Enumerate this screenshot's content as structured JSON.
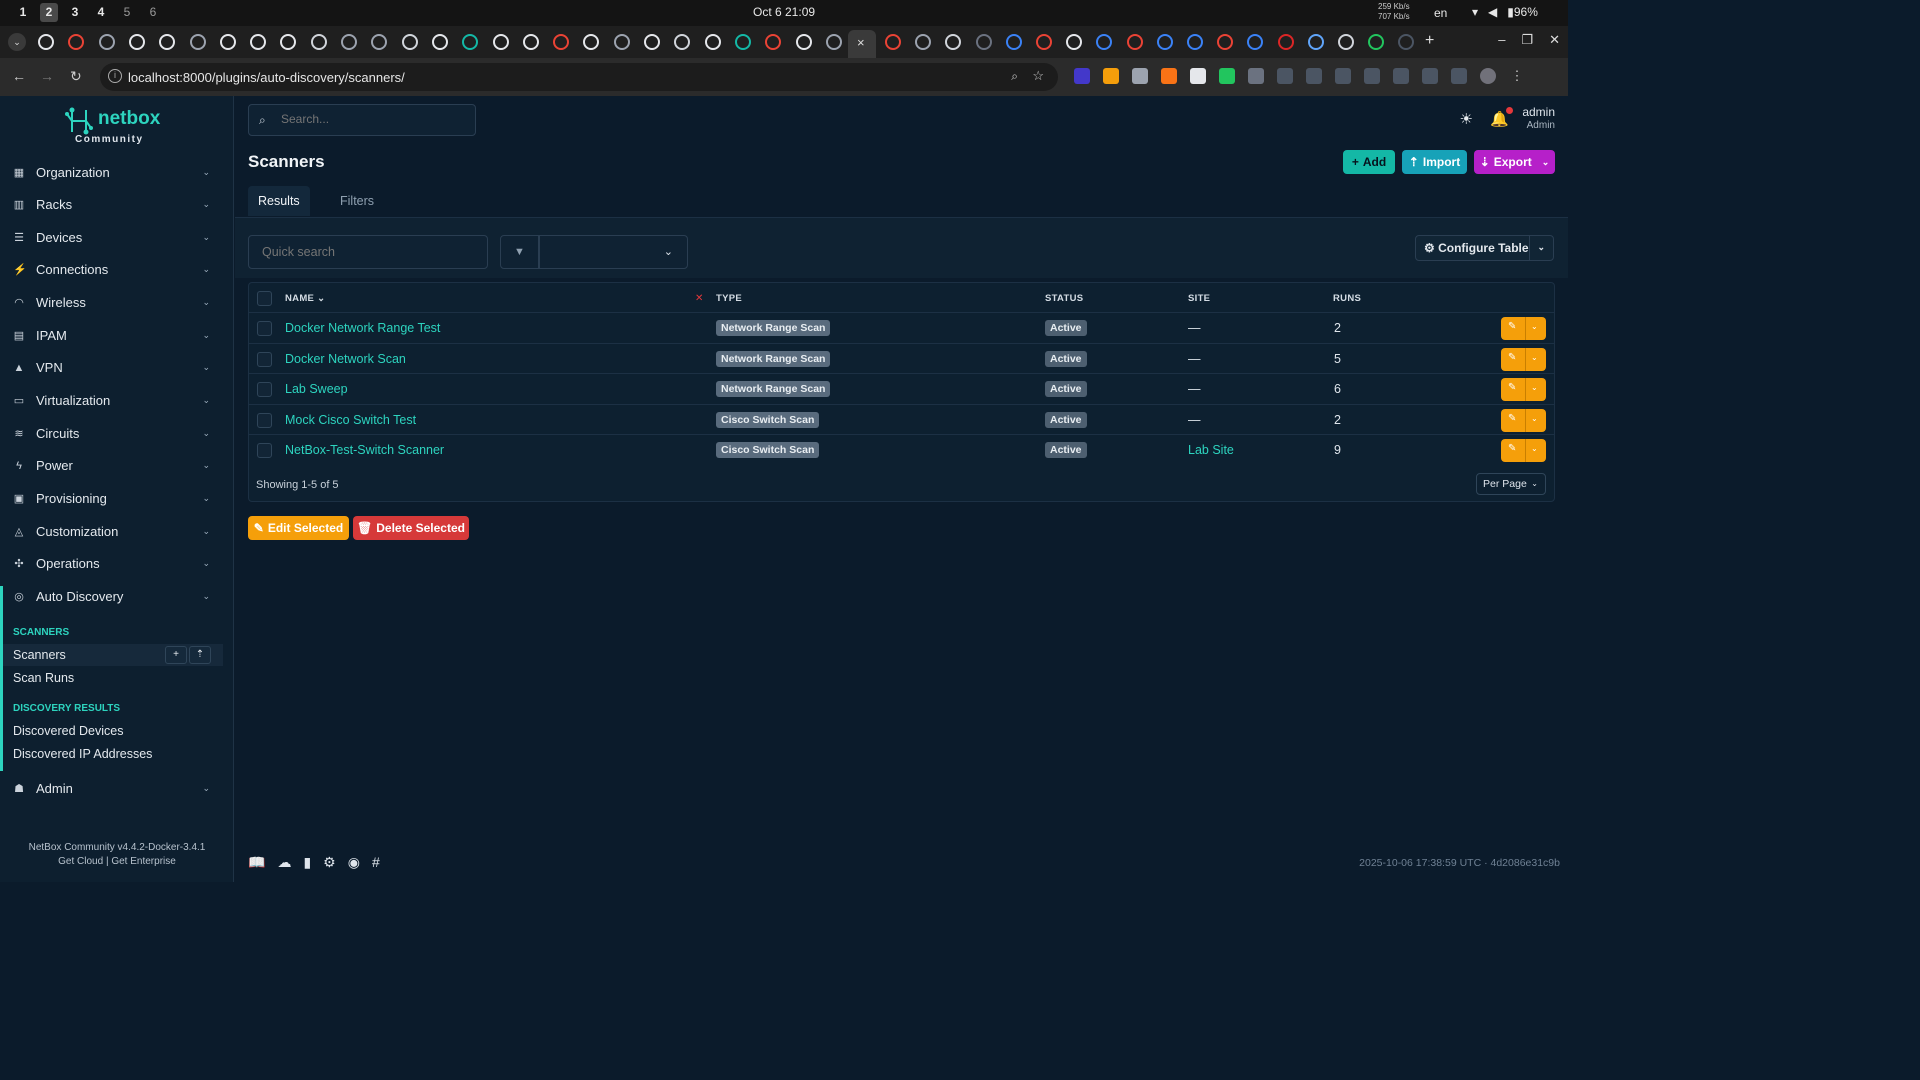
{
  "system": {
    "workspaces": [
      "1",
      "2",
      "3",
      "4",
      "5",
      "6"
    ],
    "active_workspace": "2",
    "clock": "Oct 6  21:09",
    "net_up": "259 Kb/s",
    "net_down": "707 Kb/s",
    "lang": "en",
    "battery": "96%"
  },
  "browser": {
    "url": "localhost:8000/plugins/auto-discovery/scanners/",
    "close_tab": "×",
    "new_tab": "+"
  },
  "sidebar": {
    "brand": "netbox",
    "brand_sub": "Community",
    "items": [
      {
        "label": "Organization",
        "icon": "building-icon"
      },
      {
        "label": "Racks",
        "icon": "grid-icon"
      },
      {
        "label": "Devices",
        "icon": "server-icon"
      },
      {
        "label": "Connections",
        "icon": "plug-icon"
      },
      {
        "label": "Wireless",
        "icon": "wifi-icon"
      },
      {
        "label": "IPAM",
        "icon": "counter-icon"
      },
      {
        "label": "VPN",
        "icon": "tunnel-icon"
      },
      {
        "label": "Virtualization",
        "icon": "monitor-icon"
      },
      {
        "label": "Circuits",
        "icon": "circuit-icon"
      },
      {
        "label": "Power",
        "icon": "bolt-icon"
      },
      {
        "label": "Provisioning",
        "icon": "provision-icon"
      },
      {
        "label": "Customization",
        "icon": "palette-icon"
      },
      {
        "label": "Operations",
        "icon": "cog-icon"
      },
      {
        "label": "Auto Discovery",
        "icon": "radar-icon"
      }
    ],
    "section_scanners": "SCANNERS",
    "scanners_label": "Scanners",
    "scan_runs_label": "Scan Runs",
    "section_results": "DISCOVERY RESULTS",
    "discovered_devices_label": "Discovered Devices",
    "discovered_ips_label": "Discovered IP Addresses",
    "admin_label": "Admin",
    "footer_version": "NetBox Community v4.4.2-Docker-3.4.1",
    "footer_cloud": "Get Cloud",
    "footer_enterprise": "Get Enterprise"
  },
  "header": {
    "search_placeholder": "Search...",
    "username": "admin",
    "user_role": "Admin"
  },
  "page": {
    "title": "Scanners",
    "add_label": "Add",
    "import_label": "Import",
    "export_label": "Export",
    "tab_results": "Results",
    "results_count": "5",
    "tab_filters": "Filters",
    "quick_search_placeholder": "Quick search",
    "configure_table_label": "Configure Table"
  },
  "table": {
    "columns": {
      "name": "NAME",
      "type": "TYPE",
      "status": "STATUS",
      "site": "SITE",
      "runs": "RUNS"
    },
    "rows": [
      {
        "name": "Docker Network Range Test",
        "type": "Network Range Scan",
        "status": "Active",
        "site": "—",
        "runs": "2"
      },
      {
        "name": "Docker Network Scan",
        "type": "Network Range Scan",
        "status": "Active",
        "site": "—",
        "runs": "5"
      },
      {
        "name": "Lab Sweep",
        "type": "Network Range Scan",
        "status": "Active",
        "site": "—",
        "runs": "6"
      },
      {
        "name": "Mock Cisco Switch Test",
        "type": "Cisco Switch Scan",
        "status": "Active",
        "site": "—",
        "runs": "2"
      },
      {
        "name": "NetBox-Test-Switch Scanner",
        "type": "Cisco Switch Scan",
        "status": "Active",
        "site": "Lab Site",
        "runs": "9"
      }
    ],
    "showing": "Showing 1-5 of 5",
    "per_page_label": "Per Page"
  },
  "bulk": {
    "edit_label": "Edit Selected",
    "delete_label": "Delete Selected"
  },
  "footer": {
    "timestamp": "2025-10-06 17:38:59 UTC",
    "commit": "4d2086e31c9b"
  },
  "colors": {
    "accent": "#2dd4bf",
    "add": "#14b8a6",
    "import": "#17a2b8",
    "export": "#b620c9",
    "warning": "#f59f0a",
    "danger": "#d63939"
  }
}
